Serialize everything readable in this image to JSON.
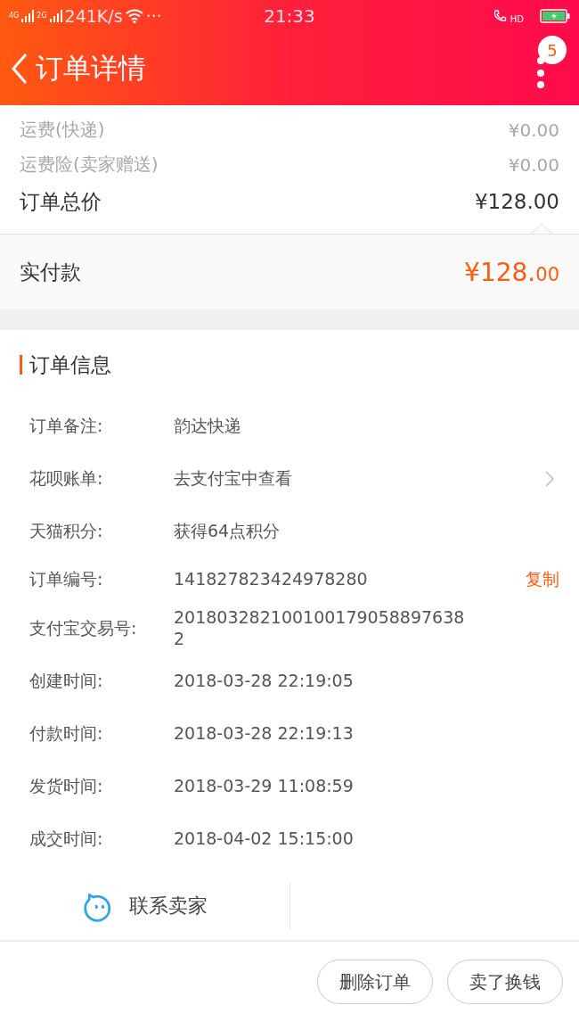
{
  "status_bar": {
    "signal_1": "4G",
    "signal_2": "2G",
    "speed": "241K/s",
    "more": "···",
    "time": "21:33",
    "call": "HD"
  },
  "header": {
    "title": "订单详情",
    "badge": "5"
  },
  "fees": [
    {
      "label": "运费(快递)",
      "value": "¥0.00"
    },
    {
      "label": "运费险(卖家赠送)",
      "value": "¥0.00"
    }
  ],
  "total": {
    "label": "订单总价",
    "value": "¥128.00"
  },
  "paid": {
    "label": "实付款",
    "value": "¥128.00"
  },
  "order_info": {
    "title": "订单信息",
    "rows": [
      {
        "kind": "plain",
        "label": "订单备注:",
        "value": "韵达快递"
      },
      {
        "kind": "link",
        "label": "花呗账单:",
        "value": "去支付宝中查看"
      },
      {
        "kind": "plain",
        "label": "天猫积分:",
        "value": "获得64点积分"
      },
      {
        "kind": "action",
        "label": "订单编号:",
        "value": "141827823424978280",
        "action": "复制"
      },
      {
        "kind": "plain",
        "label": "支付宝交易号:",
        "value": "2018032821001001790588976382"
      },
      {
        "kind": "plain",
        "label": "创建时间:",
        "value": "2018-03-28 22:19:05"
      },
      {
        "kind": "plain",
        "label": "付款时间:",
        "value": "2018-03-28 22:19:13"
      },
      {
        "kind": "plain",
        "label": "发货时间:",
        "value": "2018-03-29 11:08:59"
      },
      {
        "kind": "plain",
        "label": "成交时间:",
        "value": "2018-04-02 15:15:00"
      }
    ]
  },
  "contact": {
    "label": "联系卖家"
  },
  "buttons": [
    "删除订单",
    "卖了换钱"
  ]
}
